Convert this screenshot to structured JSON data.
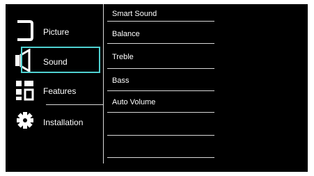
{
  "menu": {
    "items": [
      {
        "label": "Picture",
        "icon": "picture-icon"
      },
      {
        "label": "Sound",
        "icon": "speaker-icon",
        "selected": true
      },
      {
        "label": "Features",
        "icon": "features-icon"
      },
      {
        "label": "Installation",
        "icon": "gear-icon"
      }
    ]
  },
  "submenu": {
    "items": [
      "Smart Sound",
      "Balance",
      "Treble",
      "Bass",
      "Auto Volume",
      "",
      ""
    ]
  },
  "colors": {
    "background": "#000000",
    "text": "#ffffff",
    "focus": "#4fd1d1",
    "divider": "#d8d8d8"
  }
}
